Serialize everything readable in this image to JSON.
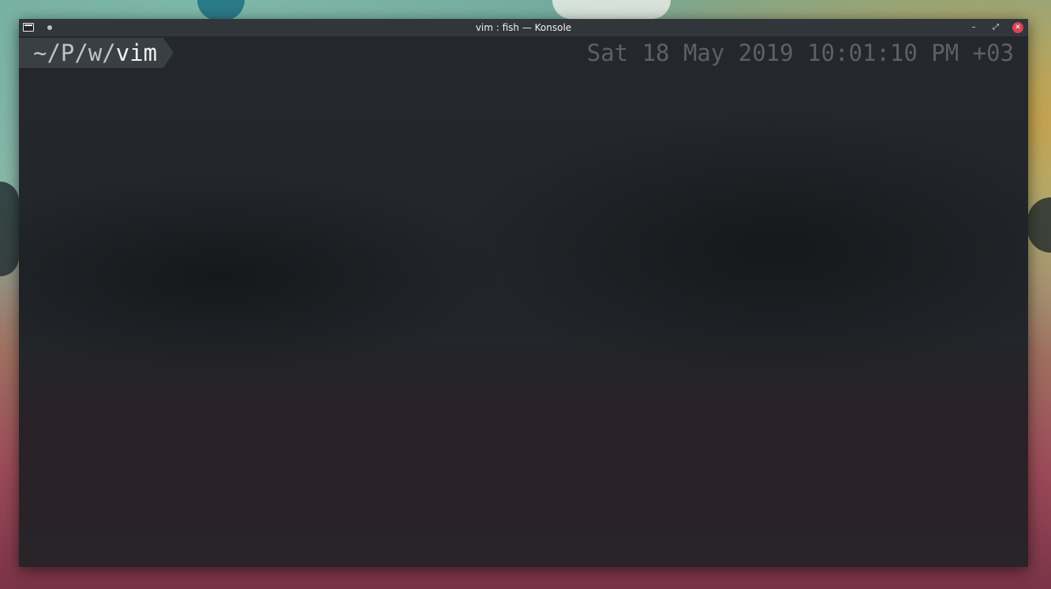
{
  "window": {
    "title": "vim : fish — Konsole",
    "icons": {
      "app": "konsole-terminal-icon",
      "pin": "pin-icon",
      "minimize": "minimize-icon",
      "maximize": "maximize-icon",
      "close": "close-icon"
    },
    "buttons": {
      "minimize_glyph": "–",
      "maximize_glyph": "⤢",
      "close_glyph": "✕"
    },
    "colors": {
      "close": "#da4453",
      "titlebar": "#31363b",
      "terminal_bg": "#232629"
    }
  },
  "prompt": {
    "path_prefix": "~/P/w/",
    "path_current": "vim",
    "right_datetime": "Sat 18 May 2019 10:01:10 PM +03"
  }
}
